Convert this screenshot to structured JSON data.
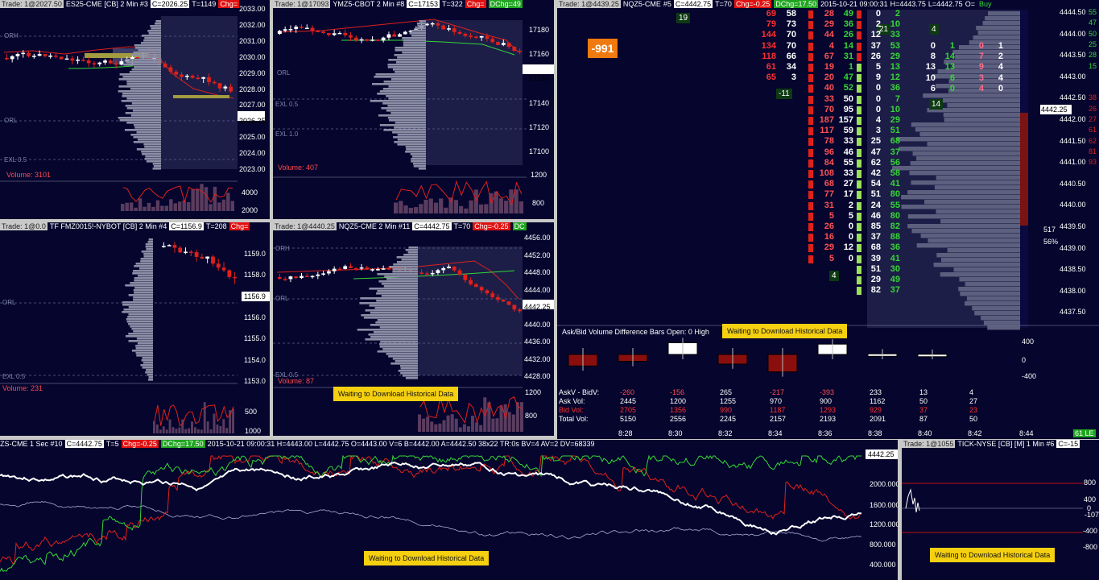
{
  "panels": {
    "es": {
      "trade": "Trade: 1@2027.50",
      "sym": "ES25-CME [CB]  2 Min  #3",
      "last": "C=2026.25",
      "ticks": "T=1149",
      "chg": "Chg=",
      "ticks_y": [
        "2033.00",
        "2032.00",
        "2031.00",
        "2030.00",
        "2029.00",
        "2028.00",
        "2027.00",
        "2026.25",
        "2025.00",
        "2024.00",
        "2023.00"
      ],
      "orh": "ORH",
      "orl": "ORL",
      "ext": "EXL 0.5",
      "vol_label": "Volume: 3101",
      "vol_ticks": [
        "4000",
        "2000"
      ]
    },
    "ym": {
      "trade": "Trade: 1@17093",
      "sym": "YMZ5-CBOT  2 Min  #8",
      "last": "C=17153",
      "ticks": "T=322",
      "chg": "Chg=",
      "dchg": "DChg=49",
      "ticks_y": [
        "17180",
        "17160",
        "17153",
        "17140",
        "17120",
        "17100"
      ],
      "orl": "ORL",
      "ext1": "EXL 0.5",
      "ext2": "EXL 1.0",
      "vol_label": "Volume: 407",
      "vol_ticks": [
        "1200",
        "800"
      ]
    },
    "tf": {
      "trade": "Trade: 1@0.0",
      "sym": "TF FMZ0015!-NYBOT [CB]  2 Min  #4",
      "last": "C=1156.9",
      "ticks": "T=208",
      "chg": "Chg=",
      "ticks_y": [
        "1159.0",
        "1158.0",
        "1156.9",
        "1156.0",
        "1155.0",
        "1154.0",
        "1153.0"
      ],
      "orl": "ORL",
      "ext": "EXL 0.5",
      "vol_label": "Volume: 231",
      "vol_ticks": [
        "500",
        "1000"
      ]
    },
    "nq": {
      "trade": "Trade: 1@4440.25",
      "sym": "NQZ5-CME  2 Min  #11",
      "last": "C=4442.75",
      "ticks": "T=70",
      "chg": "Chg=-0.25",
      "dc": "DC",
      "ticks_y": [
        "4456.00",
        "4452.00",
        "4448.00",
        "4444.00",
        "4442.25",
        "4440.00",
        "4436.00",
        "4432.00",
        "4428.00"
      ],
      "orh": "ORH",
      "orl": "ORL",
      "ext": "EXL 0.5",
      "vol_label": "Volume: 87",
      "vol_ticks": [
        "1200",
        "800"
      ],
      "waiting": "Waiting to Download Historical Data"
    }
  },
  "dom": {
    "trade": "Trade: 1@4439.25",
    "sym": "NQZ5-CME",
    "num": "#5",
    "last": "C=4442.75",
    "ticks": "T=70",
    "chg": "Chg=-0.25",
    "dchg": "DChg=17.50",
    "time": "2015-10-21 09:00:31",
    "hi": "H=4443.75",
    "lo": "L=4442.75",
    "o": "O=",
    "buy": "Buy",
    "delta_box": "-991",
    "n19": "19",
    "n21": "21",
    "n4a": "4",
    "n11": "-11",
    "n14": "14",
    "n4b": "4",
    "pct1": "517",
    "pct2": "56%",
    "last_px": "4442.25",
    "prices": [
      "4444.50",
      "4444.00",
      "4443.50",
      "4443.00",
      "4442.50",
      "4442.00",
      "4441.50",
      "4441.00",
      "4440.50",
      "4440.00",
      "4439.50",
      "4439.00",
      "4438.50",
      "4438.00",
      "4437.50"
    ],
    "right_nums": [
      "55",
      "47",
      "50",
      "25",
      "28",
      "15",
      "",
      "",
      "38",
      "26",
      "27",
      "61",
      "62",
      "81",
      "93"
    ],
    "bidask_left": [
      [
        "69",
        "58"
      ],
      [
        "79",
        "73"
      ],
      [
        "144",
        "70"
      ],
      [
        "134",
        "70"
      ],
      [
        "118",
        "66"
      ],
      [
        "61",
        "34"
      ],
      [
        "65",
        "3"
      ]
    ],
    "col2": [
      [
        "28",
        "49"
      ],
      [
        "29",
        "36"
      ],
      [
        "44",
        "26"
      ],
      [
        "4",
        "14"
      ],
      [
        "67",
        "31"
      ],
      [
        "19",
        "1"
      ],
      [
        "20",
        "47"
      ],
      [
        "40",
        "52"
      ],
      [
        "33",
        "50"
      ],
      [
        "70",
        "95"
      ],
      [
        "187",
        "157"
      ],
      [
        "117",
        "59"
      ],
      [
        "78",
        "33"
      ],
      [
        "96",
        "46"
      ],
      [
        "84",
        "55"
      ],
      [
        "108",
        "33"
      ],
      [
        "68",
        "27"
      ],
      [
        "77",
        "17"
      ],
      [
        "31",
        "2"
      ],
      [
        "5",
        "5"
      ],
      [
        "26",
        "0"
      ],
      [
        "16",
        "0"
      ],
      [
        "29",
        "12"
      ],
      [
        "5",
        "0"
      ]
    ],
    "col3": [
      [
        "0",
        "2"
      ],
      [
        "2",
        "10"
      ],
      [
        "12",
        "33"
      ],
      [
        "37",
        "53"
      ],
      [
        "26",
        "29"
      ],
      [
        "5",
        "13"
      ],
      [
        "9",
        "12"
      ],
      [
        "0",
        "36"
      ],
      [
        "0",
        "7"
      ],
      [
        "0",
        "10"
      ],
      [
        "4",
        "29"
      ],
      [
        "3",
        "51"
      ],
      [
        "25",
        "68"
      ],
      [
        "47",
        "37"
      ],
      [
        "62",
        "56"
      ],
      [
        "42",
        "58"
      ],
      [
        "54",
        "41"
      ],
      [
        "51",
        "80"
      ],
      [
        "24",
        "55"
      ],
      [
        "46",
        "80"
      ],
      [
        "85",
        "82"
      ],
      [
        "37",
        "88"
      ],
      [
        "68",
        "36"
      ],
      [
        "39",
        "41"
      ],
      [
        "51",
        "30"
      ],
      [
        "29",
        "49"
      ],
      [
        "82",
        "37"
      ]
    ],
    "col4": [
      [
        "0",
        "1"
      ],
      [
        "8",
        "14"
      ],
      [
        "13",
        "13"
      ],
      [
        "10",
        "6"
      ],
      [
        "6",
        "0"
      ]
    ],
    "col5": [
      [
        "0",
        "1"
      ],
      [
        "7",
        "2"
      ],
      [
        "9",
        "4"
      ],
      [
        "3",
        "4"
      ],
      [
        "4",
        "0"
      ]
    ],
    "diff_title": "Ask/Bid Volume Difference Bars  Open: 0  High",
    "waiting": "Waiting to Download Historical Data",
    "diff_axis": [
      "400",
      "0",
      "-400"
    ],
    "row_labels": [
      "AskV - BidV:",
      "Ask Vol:",
      "Bid Vol:",
      "Total Vol:"
    ],
    "cols": [
      {
        "d": "-260",
        "a": "2445",
        "b": "2705",
        "t": "5150",
        "time": "8:28"
      },
      {
        "d": "-156",
        "a": "1200",
        "b": "1356",
        "t": "2556",
        "time": "8:30"
      },
      {
        "d": "265",
        "a": "1255",
        "b": "990",
        "t": "2245",
        "time": "8:32"
      },
      {
        "d": "-217",
        "a": "970",
        "b": "1187",
        "t": "2157",
        "time": "8:34"
      },
      {
        "d": "-393",
        "a": "900",
        "b": "1293",
        "t": "2193",
        "time": "8:36"
      },
      {
        "d": "233",
        "a": "1162",
        "b": "929",
        "t": "2091",
        "time": "8:38"
      },
      {
        "d": "13",
        "a": "50",
        "b": "37",
        "t": "87",
        "time": "8:40"
      },
      {
        "d": "4",
        "a": "27",
        "b": "23",
        "t": "50",
        "time": "8:42"
      }
    ],
    "last_time": "8:44",
    "corner": "61 LE"
  },
  "tick1": {
    "sym": "ZS-CME  1 Sec  #10",
    "last": "C=4442.75",
    "ticks": "T=5",
    "chg": "Chg=-0.25",
    "dchg": "DChg=17.50",
    "info": "2015-10-21 09:00:31  H=4443.00  L=4442.75  O=4443.00  V=6  B=4442.00  A=4442.50  38x22  TR:0s  BV=4  AV=2  DV=68339",
    "px": "4442.25",
    "axis": [
      "2000.000",
      "1600.000",
      "1200.000",
      "800.000",
      "400.000"
    ],
    "waiting": "Waiting to Download Historical Data"
  },
  "tick2": {
    "trade": "Trade: 1@1055",
    "sym": "TICK-NYSE [CB] [M]  1 Min  #6",
    "last": "C=-15",
    "axis": [
      "800",
      "400",
      "0",
      "-107",
      "-400",
      "-800"
    ],
    "waiting": "Waiting to Download Historical Data"
  },
  "colors": {
    "bg": "#05052e",
    "up": "#ffffff",
    "down": "#e0201a",
    "green": "#36d636",
    "profile": "#8b8fa6"
  }
}
